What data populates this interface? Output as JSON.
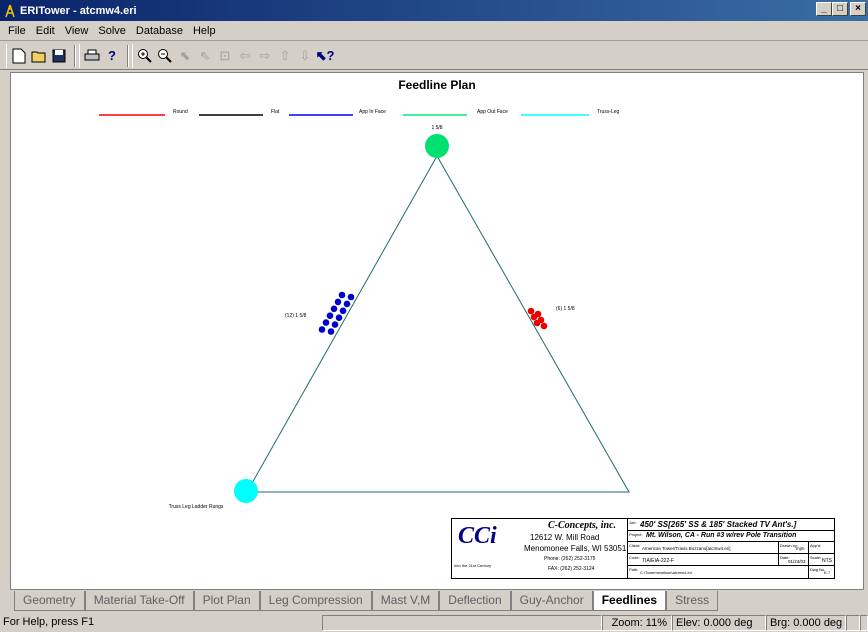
{
  "window": {
    "title": "ERITower - atcmw4.eri",
    "buttons": [
      "_",
      "□",
      "×"
    ]
  },
  "menu": [
    "File",
    "Edit",
    "View",
    "Solve",
    "Database",
    "Help"
  ],
  "toolbar": {
    "icons": [
      "new-file-icon",
      "open-folder-icon",
      "save-icon",
      "print-icon",
      "help-icon",
      "zoom-in-icon",
      "zoom-out-icon",
      "select-arrow-icon",
      "pointer-arrow-icon",
      "fit-view-icon",
      "pan-left-icon",
      "pan-right-icon",
      "pan-up-icon",
      "pan-down-icon",
      "context-help-icon"
    ]
  },
  "plot": {
    "title": "Feedline Plan",
    "legend": [
      "Round",
      "Flat",
      "App In Face",
      "App Out Face",
      "Truss-Leg"
    ],
    "legend_colors": [
      "#ff0000",
      "#000000",
      "#0000ff",
      "#00ee77",
      "#00ffff"
    ],
    "top_label": "1 5/8",
    "left_label": "(12) 1 5/8",
    "right_label": "(6) 1 5/8",
    "bottom_label": "Truss Leg Ladder Rungs",
    "colors": {
      "triangle": "#1f6b6b",
      "top_node": "#00e070",
      "bottom_node": "#00ffff",
      "left_feed": "#0000cc",
      "right_feed": "#ee0000"
    },
    "left_count": 12,
    "right_count": 6
  },
  "title_block": {
    "logo": "CCi",
    "tagline": "Into the 21st Century",
    "company": "C-Concepts, inc.",
    "address1": "12612 W. Mill Road",
    "address2": "Menomonee Falls, WI 53051",
    "phone": "Phone: (262) 252-3175",
    "fax": "FAX: (262) 252-3124",
    "job_label": "Job:",
    "job": "450' SS[265' SS & 185' Stacked TV Ant's.]",
    "project_label": "Project:",
    "project": "Mt. Wilson, CA  -  Run #3 w/rev Pole Transition",
    "client_label": "Client:",
    "client": "American Tower/Travis Bozzano[atcmw4.eri]",
    "drawn_label": "Drawn by:",
    "drawn": "mjm",
    "app_label": "App'd:",
    "code_label": "Code:",
    "code": "TIA/EIA-222-F",
    "date_label": "Date:",
    "date": "01/24/03",
    "scale_label": "Scale:",
    "scale": "NTS",
    "path_label": "Path:",
    "path": "C:\\Tower\\mwilson\\atcmw4.eri",
    "dwg_label": "Dwg No.",
    "dwg": "E-7"
  },
  "tabs": [
    "Geometry",
    "Material Take-Off",
    "Plot Plan",
    "Leg Compression",
    "Mast V,M",
    "Deflection",
    "Guy-Anchor",
    "Feedlines",
    "Stress"
  ],
  "active_tab": "Feedlines",
  "status": {
    "help": "For Help, press F1",
    "zoom": "Zoom: 11%",
    "elev": "Elev: 0.000 deg",
    "brg": "Brg: 0.000 deg"
  }
}
